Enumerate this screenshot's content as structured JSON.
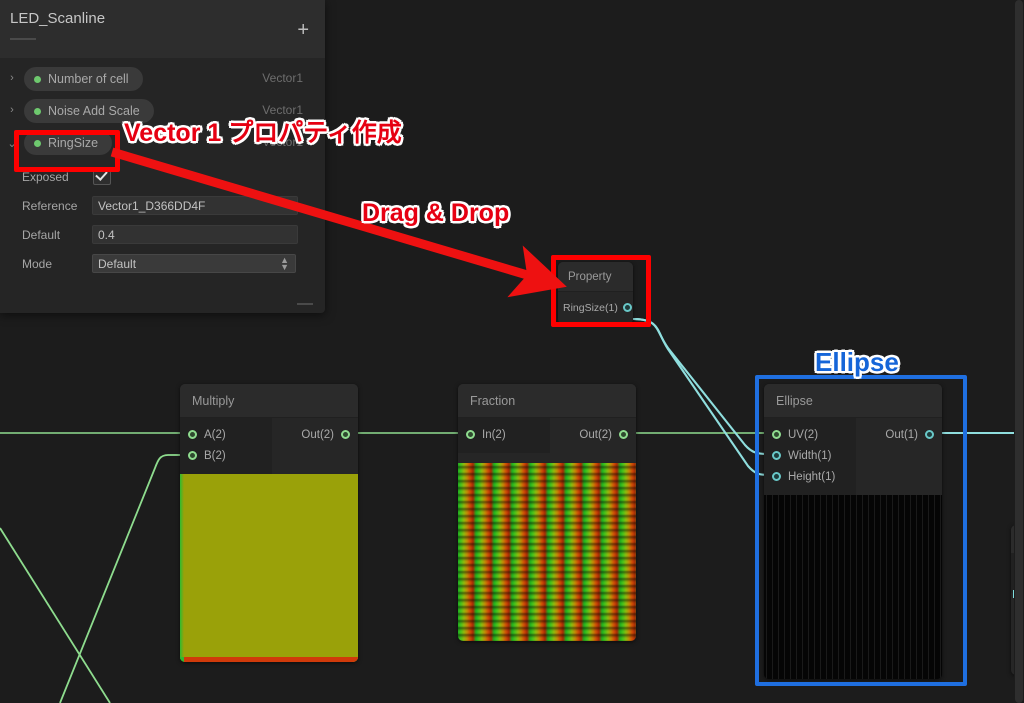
{
  "blackboard": {
    "title": "LED_Scanline",
    "add_label": "+",
    "properties": [
      {
        "name": "Number of cell",
        "type": "Vector1",
        "expander": "chevron-right",
        "expanded": false
      },
      {
        "name": "Noise Add Scale",
        "type": "Vector1",
        "expander": "chevron-right",
        "expanded": false
      },
      {
        "name": "RingSize",
        "type": "Vector1",
        "expander": "chevron-down",
        "expanded": true
      }
    ],
    "fields": [
      {
        "label": "Exposed",
        "kind": "checkbox",
        "value": "checked"
      },
      {
        "label": "Reference",
        "kind": "text",
        "value": "Vector1_D366DD4F"
      },
      {
        "label": "Default",
        "kind": "text",
        "value": "0.4"
      },
      {
        "label": "Mode",
        "kind": "select",
        "value": "Default"
      }
    ]
  },
  "nodes": {
    "property": {
      "title": "Property",
      "outputs": [
        {
          "label": "RingSize(1)",
          "color": "cyan"
        }
      ],
      "inputs": []
    },
    "multiply": {
      "title": "Multiply",
      "inputs": [
        {
          "label": "A(2)",
          "color": "green"
        },
        {
          "label": "B(2)",
          "color": "green"
        }
      ],
      "outputs": [
        {
          "label": "Out(2)",
          "color": "green"
        }
      ],
      "preview": "olive-swatch"
    },
    "fraction": {
      "title": "Fraction",
      "inputs": [
        {
          "label": "In(2)",
          "color": "green"
        }
      ],
      "outputs": [
        {
          "label": "Out(2)",
          "color": "green"
        }
      ],
      "preview": "green-red-grid"
    },
    "ellipse": {
      "title": "Ellipse",
      "inputs": [
        {
          "label": "UV(2)",
          "color": "green"
        },
        {
          "label": "Width(1)",
          "color": "cyan"
        },
        {
          "label": "Height(1)",
          "color": "cyan"
        }
      ],
      "outputs": [
        {
          "label": "Out(1)",
          "color": "cyan"
        }
      ],
      "preview": "dark-dotted"
    }
  },
  "annotations": [
    {
      "id": "create-vector1",
      "text": "Vector 1 プロパティ作成",
      "color": "#e60012"
    },
    {
      "id": "drag-drop",
      "text": "Drag & Drop",
      "color": "#e60012"
    },
    {
      "id": "ellipse-callout",
      "text": "Ellipse",
      "color": "#1565d8"
    }
  ],
  "colors": {
    "highlight_red": "#fe0000",
    "highlight_blue": "#1f6fe0",
    "arrow_red": "#ee1111",
    "wire_green": "#8edc8e",
    "wire_cyan": "#7fdede",
    "canvas_bg": "#1c1c1c",
    "node_bg": "#262626"
  }
}
